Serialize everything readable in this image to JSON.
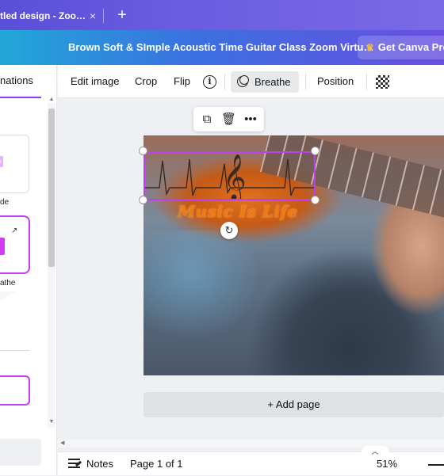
{
  "browser": {
    "tab_title": "tled design - Zoo…",
    "tab_close": "×",
    "new_tab": "+"
  },
  "header": {
    "doc_title": "Brown Soft & SImple Acoustic Time Guitar Class Zoom Virtu…",
    "canva_pro_label": "Get Canva Pro",
    "crown_icon": "crown-icon"
  },
  "left_panel": {
    "tab_label": "nations",
    "card1_label": "de",
    "card2_label": "athe"
  },
  "toolbar": {
    "edit_image": "Edit image",
    "crop": "Crop",
    "flip": "Flip",
    "info": "i",
    "breathe": "Breathe",
    "position": "Position"
  },
  "canvas": {
    "design_text": "Music Is Life",
    "add_page": "+ Add page",
    "accent_color": "#c03df0"
  },
  "footer": {
    "notes": "Notes",
    "page_indicator": "Page 1 of 1",
    "zoom": "51%"
  }
}
